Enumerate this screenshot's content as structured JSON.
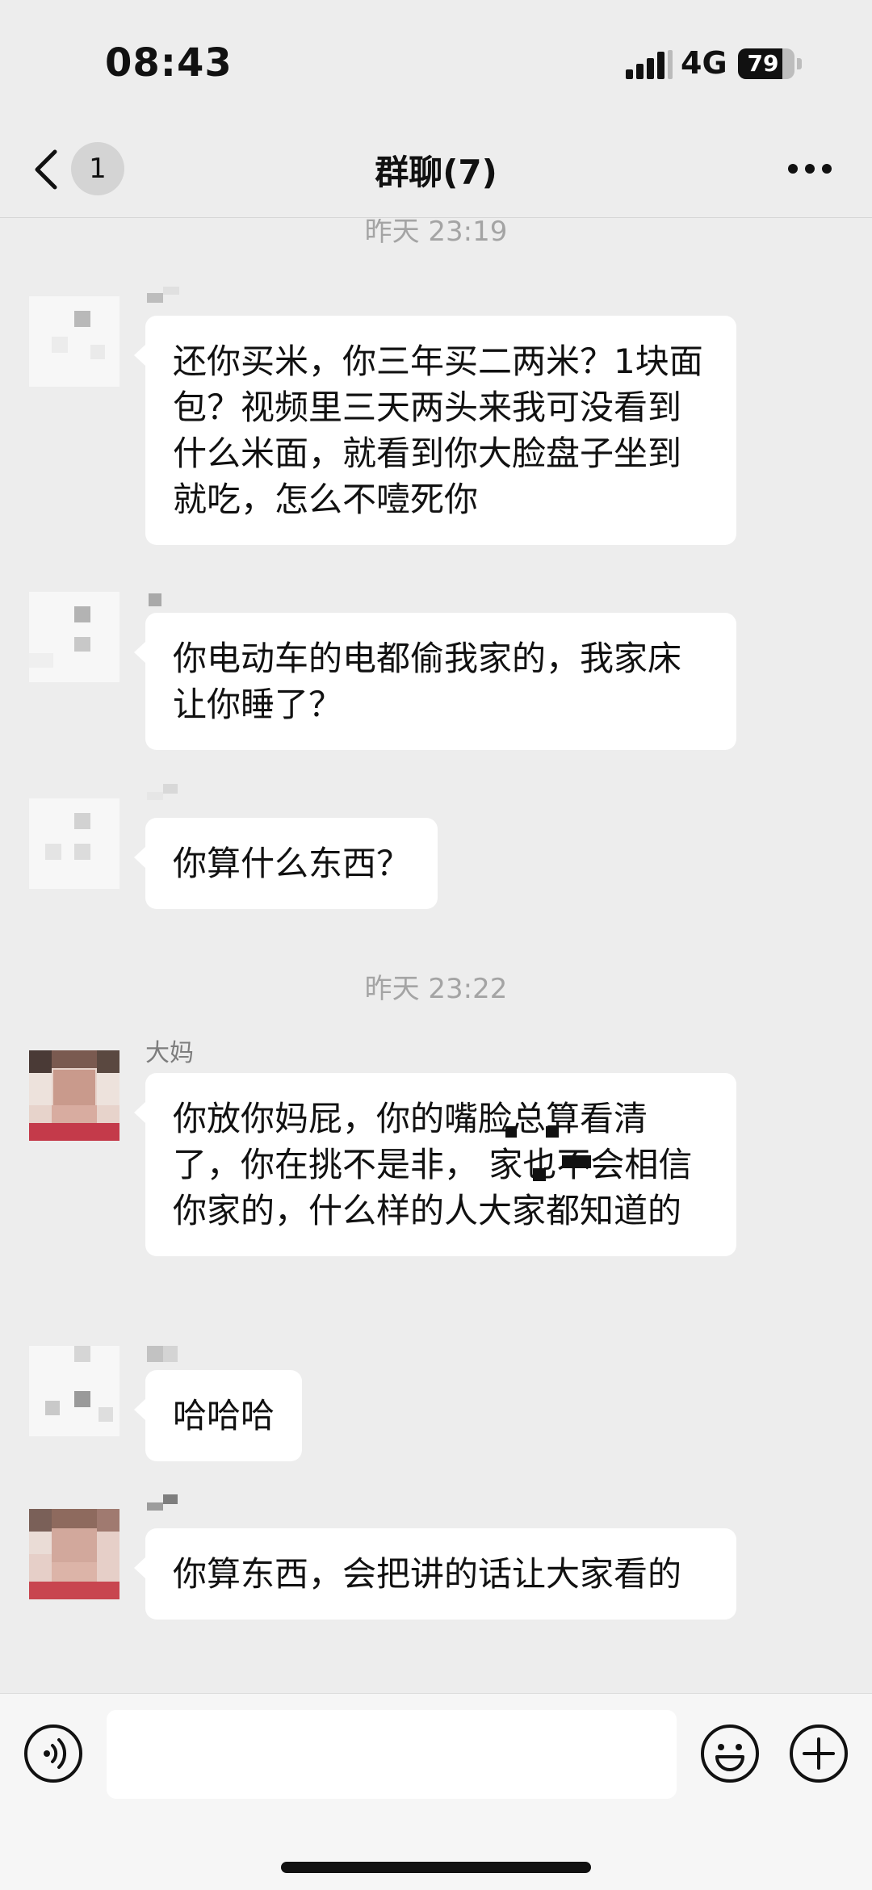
{
  "status_bar": {
    "time": "08:43",
    "network": "4G",
    "battery_level": "79",
    "battery_fraction": 0.79
  },
  "nav": {
    "unread_count": "1",
    "title": "群聊(7)",
    "back_icon": "chevron-left-icon",
    "more_icon": "ellipsis-icon"
  },
  "chat": {
    "time_labels": [
      "昨天 23:19",
      "昨天 23:22"
    ],
    "messages": [
      {
        "sender": "",
        "text": "还你买米，你三年买二两米？1块面包？视频里三天两头来我可没看到什么米面，就看到你大脸盘子坐到就吃，怎么不噎死你"
      },
      {
        "sender": "",
        "text": "你电动车的电都偷我家的，我家床让你睡了？"
      },
      {
        "sender": "",
        "text": "你算什么东西？"
      },
      {
        "sender": "大妈",
        "text": "你放你妈屁，你的嘴脸总算看清了，你在挑不是非，  家也不会相信你家的，什么样的人大家都知道的"
      },
      {
        "sender": "",
        "text": "哈哈哈"
      },
      {
        "sender": "",
        "text": "你算东西，会把讲的话让大家看的"
      }
    ]
  },
  "input_bar": {
    "placeholder": "",
    "voice_icon": "voice-icon",
    "emoji_icon": "emoji-icon",
    "plus_icon": "plus-icon"
  },
  "colors": {
    "background": "#ededed",
    "bubble": "#ffffff",
    "timestamp": "#a4a4a4",
    "sender_name": "#7d7d7d"
  }
}
